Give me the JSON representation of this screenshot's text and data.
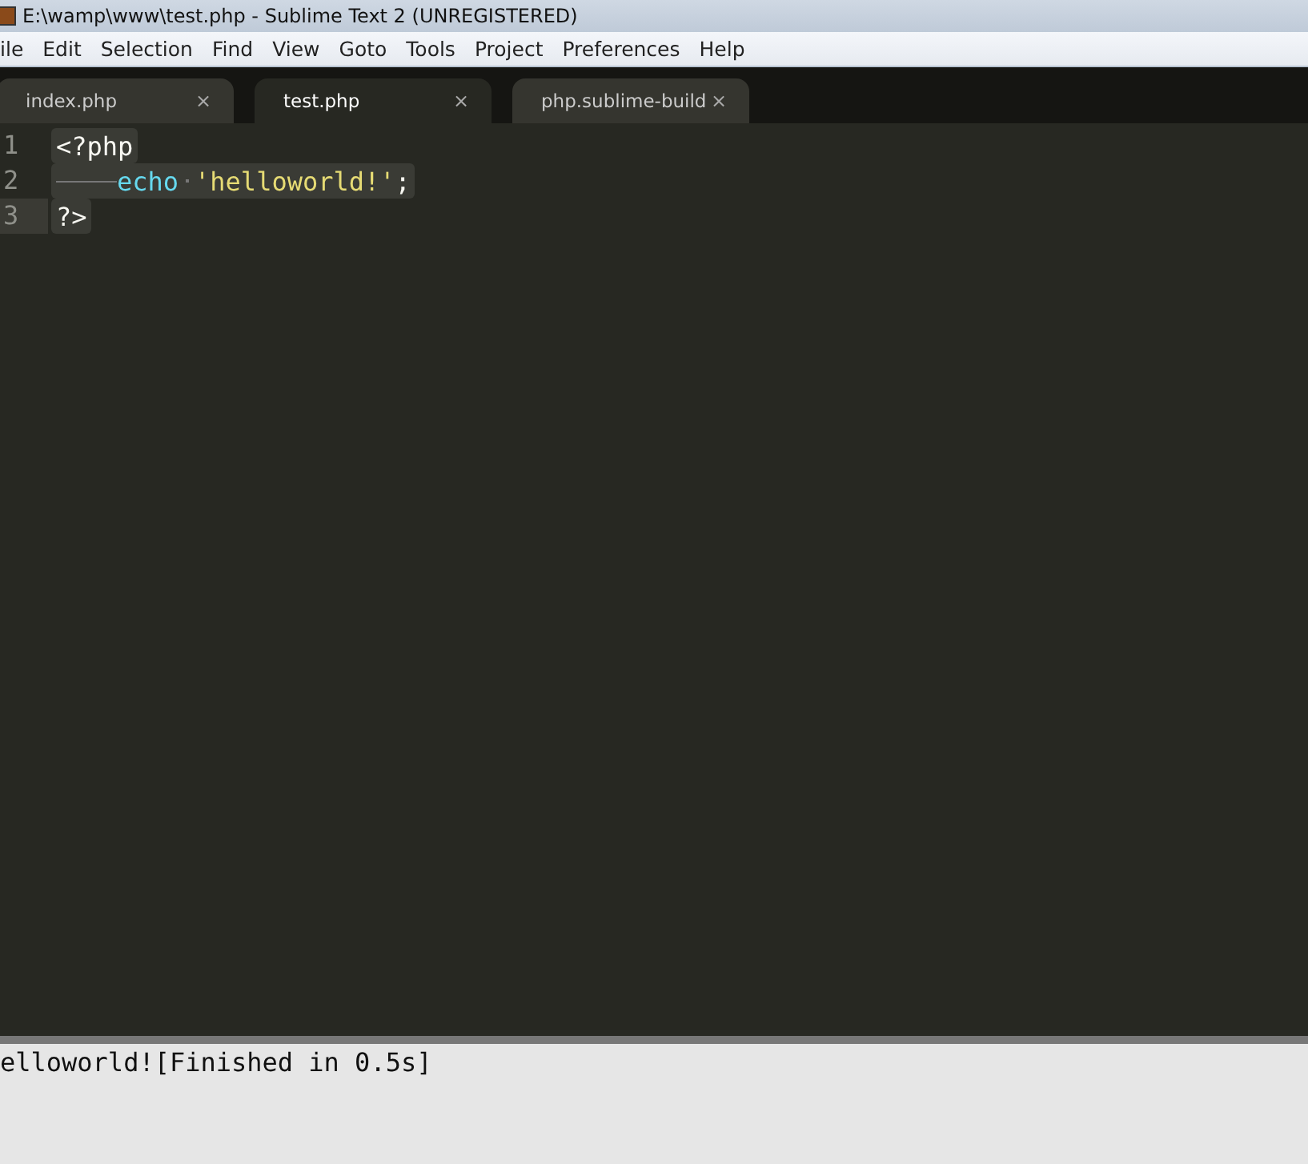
{
  "window": {
    "title": "E:\\wamp\\www\\test.php - Sublime Text 2 (UNREGISTERED)"
  },
  "menu": [
    "ile",
    "Edit",
    "Selection",
    "Find",
    "View",
    "Goto",
    "Tools",
    "Project",
    "Preferences",
    "Help"
  ],
  "tabs": [
    {
      "label": "index.php",
      "selected": false,
      "close": "×"
    },
    {
      "label": "test.php",
      "selected": true,
      "close": "×"
    },
    {
      "label": "php.sublime-build",
      "selected": false,
      "close": "×"
    }
  ],
  "editor": {
    "lines": [
      {
        "number": "1",
        "current": false,
        "tokens": [
          {
            "kind": "tag",
            "text": "<?php"
          }
        ]
      },
      {
        "number": "2",
        "current": false,
        "tokens": [
          {
            "kind": "indent"
          },
          {
            "kind": "keyword",
            "text": "echo"
          },
          {
            "kind": "space"
          },
          {
            "kind": "string",
            "text": "'helloworld!'"
          },
          {
            "kind": "plain",
            "text": ";"
          }
        ]
      },
      {
        "number": "3",
        "current": true,
        "tokens": [
          {
            "kind": "tag",
            "text": "?>"
          }
        ]
      }
    ]
  },
  "output": {
    "text": "elloworld![Finished in 0.5s]"
  }
}
